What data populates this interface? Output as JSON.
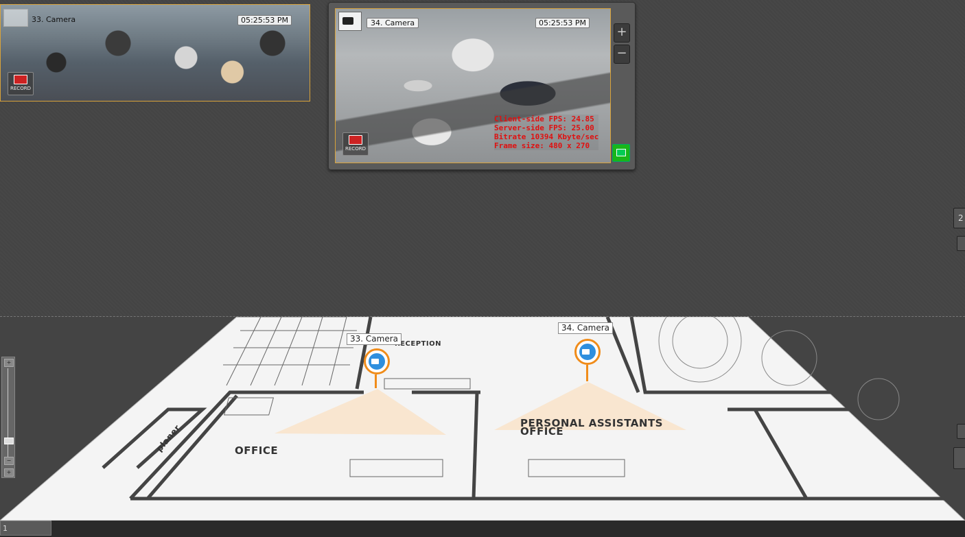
{
  "cameras": [
    {
      "name": "33. Camera",
      "time": "05:25:53 PM",
      "record": "RECORD"
    },
    {
      "name": "34. Camera",
      "time": "05:25:53 PM",
      "record": "RECORD",
      "stats": [
        "Client-side FPS: 24.85",
        "Server-side FPS: 25.00",
        "Bitrate 10394 Kbyte/sec",
        "Frame size: 480 x 270"
      ]
    }
  ],
  "panel": {
    "zoom_in": "+",
    "zoom_out": "−"
  },
  "plan": {
    "rooms": [
      "OFFICE",
      "PERSONAL ASSISTANTS",
      "OFFICE",
      "RECEPTION",
      "planer"
    ],
    "pins": [
      "33. Camera",
      "34. Camera"
    ]
  },
  "right_panel": {
    "top_label": "2"
  },
  "pages": {
    "current": "1"
  }
}
